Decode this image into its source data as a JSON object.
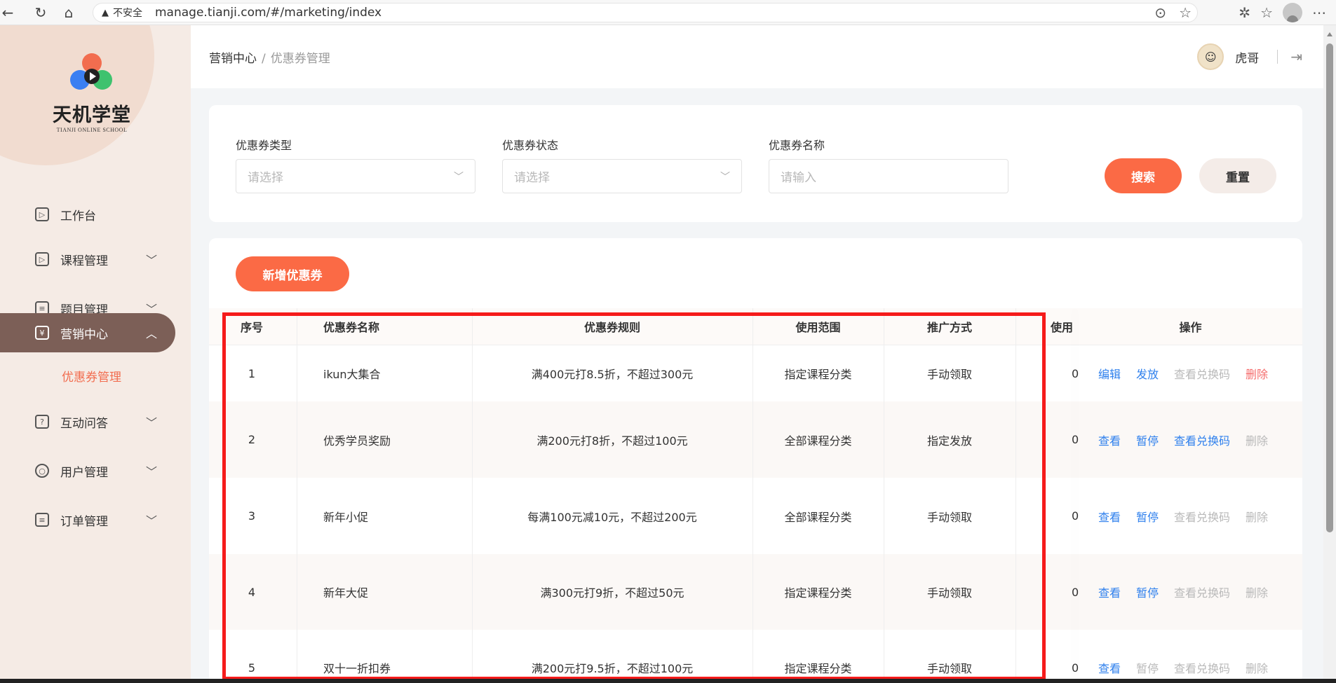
{
  "browser": {
    "insecure_label": "不安全",
    "url": "manage.tianji.com/#/marketing/index"
  },
  "brand": {
    "name": "天机学堂",
    "subtitle": "TIANJI ONLINE SCHOOL"
  },
  "sidebar": {
    "items": [
      {
        "label": "工作台",
        "icon": "dashboard-icon"
      },
      {
        "label": "课程管理",
        "icon": "course-icon"
      },
      {
        "label": "题目管理",
        "icon": "question-icon"
      },
      {
        "label": "营销中心",
        "icon": "marketing-icon",
        "active": true
      },
      {
        "label": "互动问答",
        "icon": "qa-icon"
      },
      {
        "label": "用户管理",
        "icon": "user-icon"
      },
      {
        "label": "订单管理",
        "icon": "order-icon"
      }
    ],
    "submenu": {
      "label": "优惠券管理"
    }
  },
  "header": {
    "breadcrumb_parent": "营销中心",
    "breadcrumb_sep": "/",
    "breadcrumb_current": "优惠券管理",
    "user_name": "虎哥"
  },
  "filter": {
    "type_label": "优惠券类型",
    "type_placeholder": "请选择",
    "status_label": "优惠券状态",
    "status_placeholder": "请选择",
    "name_label": "优惠券名称",
    "name_placeholder": "请输入",
    "search_label": "搜索",
    "reset_label": "重置"
  },
  "table": {
    "add_label": "新增优惠券",
    "columns": [
      "序号",
      "优惠券名称",
      "优惠券规则",
      "使用范围",
      "推广方式",
      "使用",
      "操作"
    ],
    "rows": [
      {
        "no": "1",
        "name": "ikun大集合",
        "rule": "满400元打8.5折，不超过300元",
        "scope": "指定课程分类",
        "method": "手动领取",
        "used": "0",
        "ops": [
          {
            "label": "编辑",
            "style": "blue"
          },
          {
            "label": "发放",
            "style": "blue"
          },
          {
            "label": "查看兑换码",
            "style": "gray"
          },
          {
            "label": "删除",
            "style": "red"
          }
        ]
      },
      {
        "no": "2",
        "name": "优秀学员奖励",
        "rule": "满200元打8折，不超过100元",
        "scope": "全部课程分类",
        "method": "指定发放",
        "used": "0",
        "ops": [
          {
            "label": "查看",
            "style": "blue"
          },
          {
            "label": "暂停",
            "style": "blue"
          },
          {
            "label": "查看兑换码",
            "style": "blue"
          },
          {
            "label": "删除",
            "style": "gray"
          }
        ]
      },
      {
        "no": "3",
        "name": "新年小促",
        "rule": "每满100元减10元，不超过200元",
        "scope": "全部课程分类",
        "method": "手动领取",
        "used": "0",
        "ops": [
          {
            "label": "查看",
            "style": "blue"
          },
          {
            "label": "暂停",
            "style": "blue"
          },
          {
            "label": "查看兑换码",
            "style": "gray"
          },
          {
            "label": "删除",
            "style": "gray"
          }
        ]
      },
      {
        "no": "4",
        "name": "新年大促",
        "rule": "满300元打9折，不超过50元",
        "scope": "指定课程分类",
        "method": "手动领取",
        "used": "0",
        "ops": [
          {
            "label": "查看",
            "style": "blue"
          },
          {
            "label": "暂停",
            "style": "blue"
          },
          {
            "label": "查看兑换码",
            "style": "gray"
          },
          {
            "label": "删除",
            "style": "gray"
          }
        ]
      },
      {
        "no": "5",
        "name": "双十一折扣券",
        "rule": "满200元打9.5折，不超过100元",
        "scope": "指定课程分类",
        "method": "手动领取",
        "used": "0",
        "ops": [
          {
            "label": "查看",
            "style": "blue"
          },
          {
            "label": "暂停",
            "style": "gray"
          },
          {
            "label": "查看兑换码",
            "style": "gray"
          },
          {
            "label": "删除",
            "style": "gray"
          }
        ]
      }
    ]
  },
  "colors": {
    "accent": "#fb6a45",
    "sidebar_active": "#7c5f57",
    "link_blue": "#2f80ed",
    "highlight_box": "#f51b1b"
  }
}
